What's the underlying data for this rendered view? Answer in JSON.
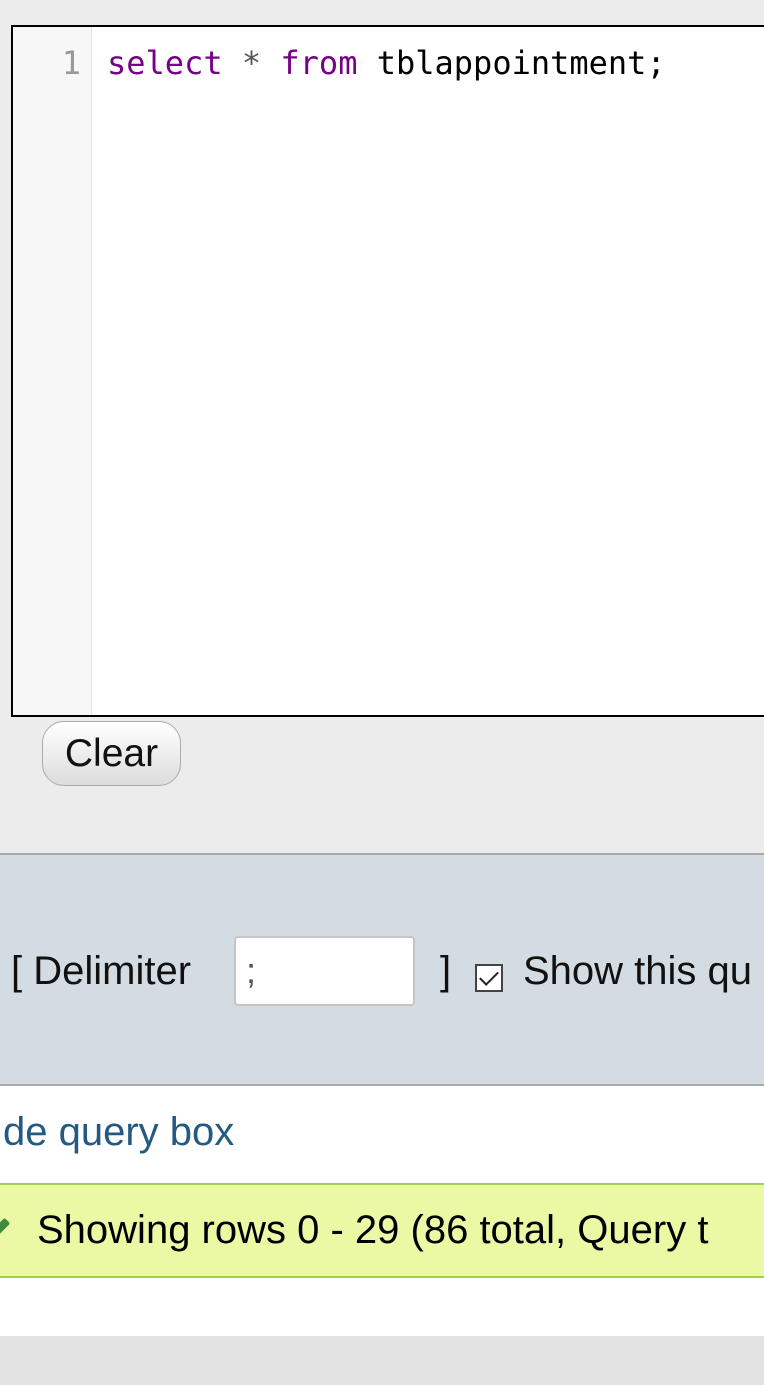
{
  "editor": {
    "line_number": "1",
    "code": {
      "kw_select": "select",
      "star": "*",
      "kw_from": "from",
      "table": "tblappointment;"
    }
  },
  "buttons": {
    "clear_label": "Clear"
  },
  "options": {
    "delimiter_open": "[ Delimiter",
    "delimiter_value": ";",
    "delimiter_close": "]",
    "show_query_checked": true,
    "show_query_label": "Show this qu"
  },
  "links": {
    "hide_query_box": "de query box"
  },
  "status": {
    "message": "Showing rows 0 - 29 (86 total, Query t"
  },
  "colors": {
    "keyword": "#770088",
    "success_bg": "#ebf8a4",
    "options_bg": "#d4dce3",
    "link": "#235a81"
  }
}
